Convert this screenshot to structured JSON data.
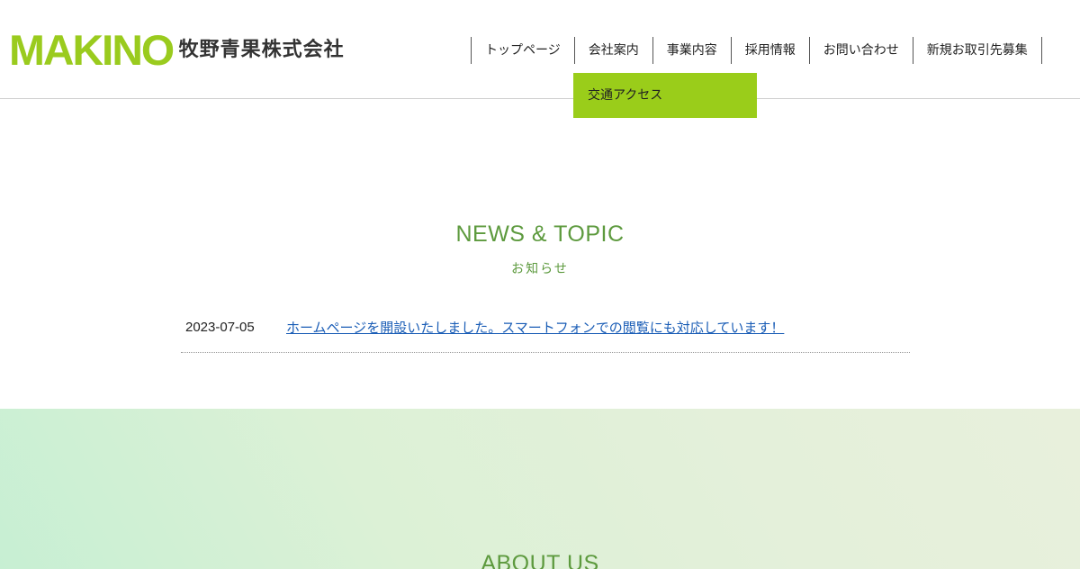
{
  "header": {
    "logo_mark": "MAKINO",
    "company_name": "牧野青果株式会社"
  },
  "nav": {
    "items": [
      {
        "label": "トップページ"
      },
      {
        "label": "会社案内"
      },
      {
        "label": "事業内容"
      },
      {
        "label": "採用情報"
      },
      {
        "label": "お問い合わせ"
      },
      {
        "label": "新規お取引先募集"
      }
    ],
    "dropdown": {
      "parent": "会社案内",
      "items": [
        {
          "label": "交通アクセス"
        }
      ]
    }
  },
  "news": {
    "title": "NEWS & TOPIC",
    "subtitle": "お知らせ",
    "items": [
      {
        "date": "2023-07-05",
        "text": "ホームページを開設いたしました。スマートフォンでの閲覧にも対応しています！"
      }
    ]
  },
  "about": {
    "title": "ABOUT US"
  },
  "colors": {
    "brand_green": "#9acb1e",
    "heading_green": "#5d9a3e",
    "link_blue": "#1a5db6"
  }
}
